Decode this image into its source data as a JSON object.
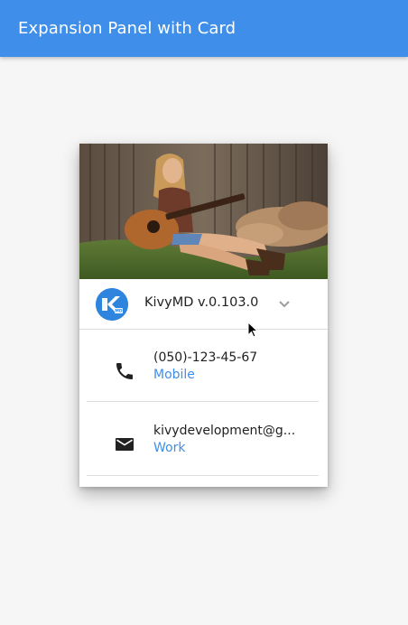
{
  "appbar": {
    "title": "Expansion Panel with Card"
  },
  "panel": {
    "title": "KivyMD v.0.103.0",
    "avatar_icon": "kivymd-logo-icon",
    "expand_icon": "chevron-down-icon",
    "items": [
      {
        "icon": "phone-icon",
        "primary": "(050)-123-45-67",
        "secondary": "Mobile"
      },
      {
        "icon": "email-icon",
        "primary": "kivydevelopment@g...",
        "secondary": "Work"
      }
    ]
  },
  "colors": {
    "primary": "#3f8ee9",
    "background": "#f6f6f6",
    "text": "#212121"
  }
}
